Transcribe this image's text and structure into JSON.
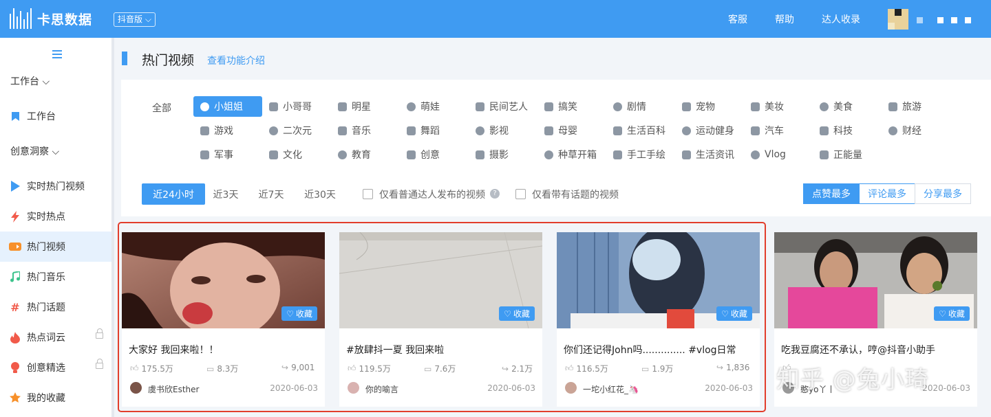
{
  "app": {
    "brand": "卡思数据",
    "edition": "抖音版 ⌵"
  },
  "topnav": {
    "service": "客服",
    "help": "帮助",
    "collect": "达人收录"
  },
  "sidebar": {
    "section1": "工作台 ⌵",
    "workbench": "工作台",
    "section2": "创意洞察 ⌵",
    "items": [
      {
        "label": "实时热门视频",
        "icon": "play-icon",
        "color": "#3f9bf2"
      },
      {
        "label": "实时热点",
        "icon": "lightning-icon",
        "color": "#f15a4a"
      },
      {
        "label": "热门视频",
        "icon": "video-camera-icon",
        "color": "#f7902a"
      },
      {
        "label": "热门音乐",
        "icon": "music-note-icon",
        "color": "#3cc38c"
      },
      {
        "label": "热门话题",
        "icon": "hashtag-icon",
        "color": "#f15a4a"
      },
      {
        "label": "热点词云",
        "icon": "fire-icon",
        "color": "#f15a4a"
      },
      {
        "label": "创意精选",
        "icon": "lightbulb-icon",
        "color": "#f15a4a"
      },
      {
        "label": "我的收藏",
        "icon": "star-icon",
        "color": "#f7902a"
      }
    ]
  },
  "page": {
    "title": "热门视频",
    "intro_link": "查看功能介绍"
  },
  "categories": {
    "all": "全部",
    "items": [
      "小姐姐",
      "小哥哥",
      "明星",
      "萌娃",
      "民间艺人",
      "搞笑",
      "剧情",
      "宠物",
      "美妆",
      "美食",
      "旅游",
      "游戏",
      "二次元",
      "音乐",
      "舞蹈",
      "影视",
      "母婴",
      "生活百科",
      "运动健身",
      "汽车",
      "科技",
      "财经",
      "军事",
      "文化",
      "教育",
      "创意",
      "摄影",
      "种草开箱",
      "手工手绘",
      "生活资讯",
      "Vlog",
      "正能量"
    ],
    "selected": "小姐姐"
  },
  "filters": {
    "time_ranges": [
      "近24小时",
      "近3天",
      "近7天",
      "近30天"
    ],
    "selected_time": "近24小时",
    "check_normal": "仅看普通达人发布的视频",
    "check_topic": "仅看带有话题的视频",
    "help_symbol": "?",
    "sort": [
      "点赞最多",
      "评论最多",
      "分享最多"
    ],
    "selected_sort": "点赞最多"
  },
  "fav_label": "收藏",
  "cards": [
    {
      "title": "大家好 我回来啦！！",
      "likes": "175.5万",
      "comments": "8.3万",
      "shares": "9,001",
      "author": "虞书欣Esther",
      "date": "2020-06-03"
    },
    {
      "title": "#放肆抖一夏 我回来啦",
      "likes": "119.5万",
      "comments": "7.6万",
      "shares": "2.1万",
      "author": "你的喻言",
      "date": "2020-06-03"
    },
    {
      "title": "你们还记得John吗.............. #vlog日常",
      "likes": "116.5万",
      "comments": "1.9万",
      "shares": "1,836",
      "author": "一坨小红花_🦄",
      "date": "2020-06-03"
    },
    {
      "title": "吃我豆腐还不承认，哼@抖音小助手",
      "likes": "",
      "comments": "",
      "shares": "",
      "author": "憨yo丫丨",
      "date": "2020-06-03"
    }
  ],
  "watermark": "知乎 @兔小琦"
}
